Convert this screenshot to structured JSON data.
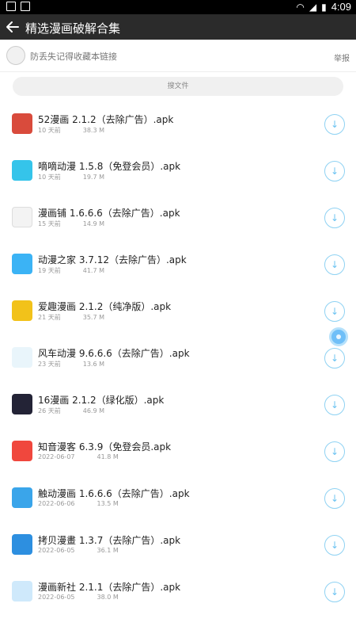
{
  "status_bar": {
    "time": "4:09"
  },
  "toolbar": {
    "title": "精选漫画破解合集"
  },
  "share_bar": {
    "text": "防丢失记得收藏本链接",
    "report": "举报"
  },
  "search": {
    "placeholder": "搜文件"
  },
  "items": [
    {
      "name": "52漫画 2.1.2（去除广告）.apk",
      "date": "10 天前",
      "size": "38.3 M"
    },
    {
      "name": "嘀嘀动漫 1.5.8（免登会员）.apk",
      "date": "10 天前",
      "size": "19.7 M"
    },
    {
      "name": "漫画铺 1.6.6.6（去除广告）.apk",
      "date": "15 天前",
      "size": "14.9 M"
    },
    {
      "name": "动漫之家 3.7.12（去除广告）.apk",
      "date": "19 天前",
      "size": "41.7 M"
    },
    {
      "name": "爱趣漫画 2.1.2（纯净版）.apk",
      "date": "21 天前",
      "size": "35.7 M"
    },
    {
      "name": "风车动漫 9.6.6.6（去除广告）.apk",
      "date": "23 天前",
      "size": "13.6 M"
    },
    {
      "name": "16漫画 2.1.2（绿化版）.apk",
      "date": "26 天前",
      "size": "46.9 M"
    },
    {
      "name": "知音漫客 6.3.9（免登会员.apk",
      "date": "2022-06-07",
      "size": "41.8 M"
    },
    {
      "name": "触动漫画 1.6.6.6（去除广告）.apk",
      "date": "2022-06-06",
      "size": "13.5 M"
    },
    {
      "name": "拷贝漫畫 1.3.7（去除广告）.apk",
      "date": "2022-06-05",
      "size": "36.1 M"
    },
    {
      "name": "漫画新社 2.1.1（去除广告）.apk",
      "date": "2022-06-05",
      "size": "38.0 M"
    }
  ]
}
